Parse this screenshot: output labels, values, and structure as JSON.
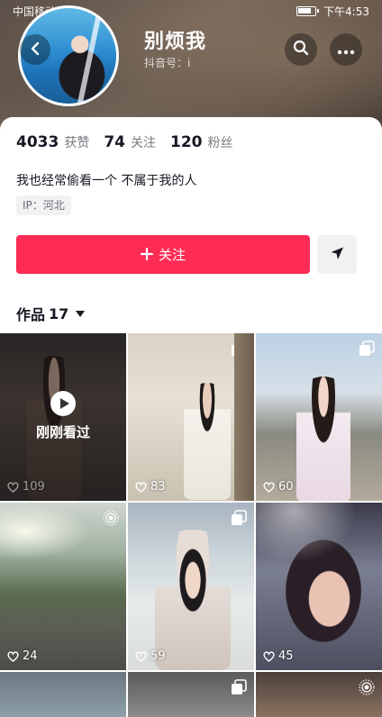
{
  "status_bar": {
    "carrier": "中国移动",
    "time": "下午4:53"
  },
  "profile": {
    "nickname": "别烦我",
    "douyin_id_label": "抖音号：i",
    "stats": [
      {
        "value": "4033",
        "label": "获赞"
      },
      {
        "value": "74",
        "label": "关注"
      },
      {
        "value": "120",
        "label": "粉丝"
      }
    ],
    "bio": "我也经常偷看一个 不属于我的人",
    "ip": "IP：河北"
  },
  "actions": {
    "follow_label": "关注"
  },
  "tabs": {
    "works_label": "作品",
    "works_count": "17"
  },
  "works": [
    {
      "likes": "109",
      "overlay": "刚刚看过"
    },
    {
      "likes": "83"
    },
    {
      "likes": "60"
    },
    {
      "likes": "24"
    },
    {
      "likes": "59"
    },
    {
      "likes": "45"
    }
  ],
  "colors": {
    "follow_button": "#fe2c55",
    "text_primary": "#161823",
    "text_secondary": "#7a7b80"
  },
  "icons": [
    "back-icon",
    "search-icon",
    "more-icon",
    "plus-icon",
    "share-icon",
    "caret-down-icon",
    "heart-icon",
    "play-icon",
    "multi-image-icon",
    "live-photo-icon"
  ]
}
